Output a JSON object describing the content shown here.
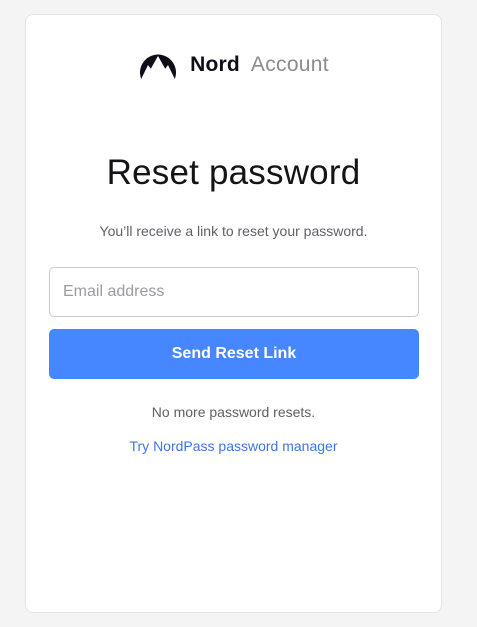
{
  "brand": {
    "name": "Nord",
    "sub": "Account"
  },
  "page": {
    "title": "Reset password",
    "subtitle": "You’ll receive a link to reset your password."
  },
  "form": {
    "email_placeholder": "Email address",
    "email_value": "",
    "submit_label": "Send Reset Link"
  },
  "footer": {
    "note": "No more password resets.",
    "link_label": "Try NordPass password manager"
  },
  "colors": {
    "accent": "#4687ff",
    "link": "#3e74e6",
    "logo": "#0e0e19"
  },
  "icons": {
    "logo": "nord-mountain-logo-icon"
  }
}
